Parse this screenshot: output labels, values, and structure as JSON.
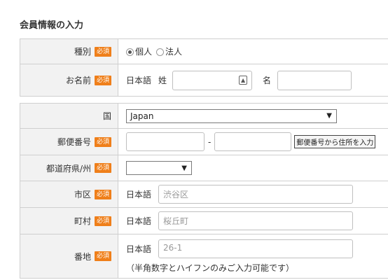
{
  "title": "会員情報の入力",
  "required_label": "必須",
  "type_row": {
    "label": "種別",
    "options": [
      "個人",
      "法人"
    ],
    "selected": "個人"
  },
  "name_row": {
    "label": "お名前",
    "lang": "日本語",
    "last_label": "姓",
    "first_label": "名",
    "card_icon": "contact-card-icon"
  },
  "country_row": {
    "label": "国",
    "value": "Japan"
  },
  "zip_row": {
    "label": "郵便番号",
    "separator": "-",
    "button": "郵便番号から住所を入力"
  },
  "pref_row": {
    "label": "都道府県/州",
    "value": ""
  },
  "city_row": {
    "label": "市区",
    "lang": "日本語",
    "placeholder": "渋谷区"
  },
  "town_row": {
    "label": "町村",
    "lang": "日本語",
    "placeholder": "桜丘町"
  },
  "addr_row": {
    "label": "番地",
    "lang": "日本語",
    "placeholder": "26-1",
    "note": "（半角数字とハイフンのみご入力可能です）"
  },
  "colors": {
    "accent": "#ef7f1a",
    "label_bg": "#f2f2f2",
    "border": "#cfcfcf"
  }
}
